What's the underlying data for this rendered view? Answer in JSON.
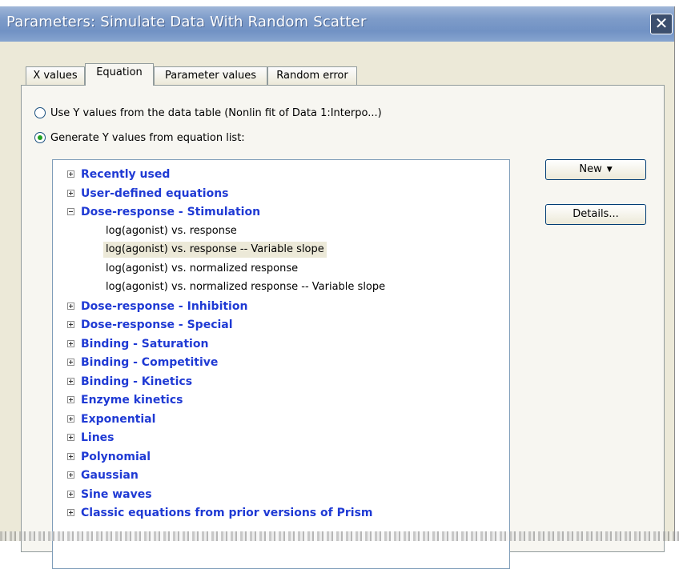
{
  "window": {
    "title": "Parameters: Simulate Data With Random Scatter",
    "close_glyph": "✕"
  },
  "tabs": [
    {
      "label": "X values",
      "active": false
    },
    {
      "label": "Equation",
      "active": true
    },
    {
      "label": "Parameter values",
      "active": false
    },
    {
      "label": "Random error",
      "active": false
    }
  ],
  "source_options": [
    {
      "label": "Use Y values from the data table (Nonlin fit of Data 1:Interpo...)",
      "selected": false
    },
    {
      "label": "Generate Y values from equation list:",
      "selected": true
    }
  ],
  "equation_tree": [
    {
      "label": "Recently used",
      "expanded": false
    },
    {
      "label": "User-defined equations",
      "expanded": false
    },
    {
      "label": "Dose-response - Stimulation",
      "expanded": true,
      "children": [
        {
          "label": "log(agonist) vs. response",
          "selected": false
        },
        {
          "label": "log(agonist) vs. response -- Variable slope",
          "selected": true
        },
        {
          "label": "log(agonist) vs. normalized response",
          "selected": false
        },
        {
          "label": "log(agonist) vs. normalized response -- Variable slope",
          "selected": false
        }
      ]
    },
    {
      "label": "Dose-response - Inhibition",
      "expanded": false
    },
    {
      "label": "Dose-response - Special",
      "expanded": false
    },
    {
      "label": "Binding - Saturation",
      "expanded": false
    },
    {
      "label": "Binding - Competitive",
      "expanded": false
    },
    {
      "label": "Binding - Kinetics",
      "expanded": false
    },
    {
      "label": "Enzyme kinetics",
      "expanded": false
    },
    {
      "label": "Exponential",
      "expanded": false
    },
    {
      "label": "Lines",
      "expanded": false
    },
    {
      "label": "Polynomial",
      "expanded": false
    },
    {
      "label": "Gaussian",
      "expanded": false
    },
    {
      "label": "Sine waves",
      "expanded": false
    },
    {
      "label": "Classic equations from prior versions of Prism",
      "expanded": false
    }
  ],
  "buttons": {
    "new_label": "New",
    "details_label": "Details..."
  }
}
